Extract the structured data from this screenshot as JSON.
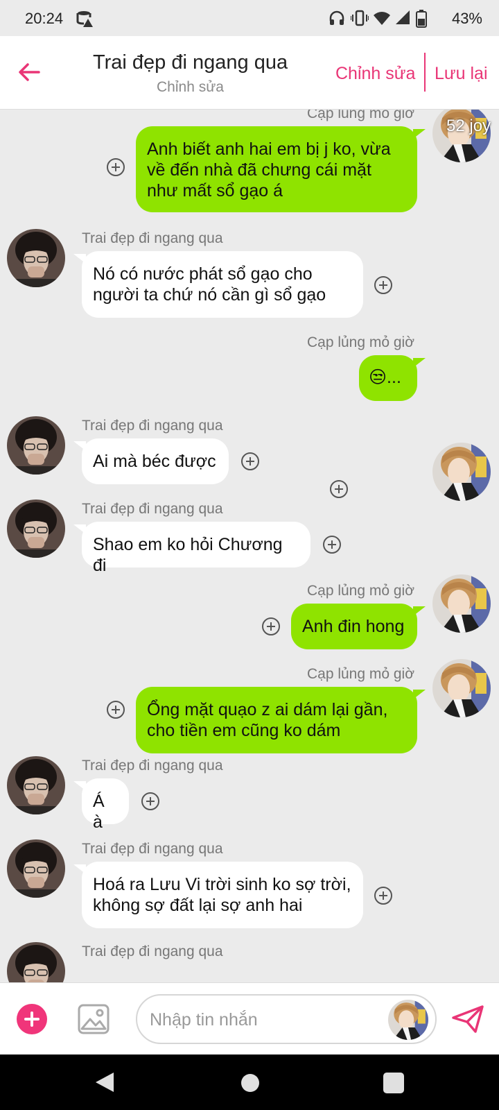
{
  "status_bar": {
    "time": "20:24",
    "battery": "43%",
    "icons": [
      "sim-alert-icon",
      "headphones-icon",
      "vibrate-icon",
      "wifi-icon",
      "signal-icon",
      "battery-icon"
    ]
  },
  "header": {
    "title": "Trai đẹp đi ngang qua",
    "subtitle": "Chỉnh sửa",
    "edit_label": "Chỉnh sửa",
    "save_label": "Lưu lại",
    "accent_color": "#e93576"
  },
  "chat": {
    "overlay_text": "52 joy",
    "messages": [
      {
        "direction": "out",
        "sender": "Cạp lủng mỏ giờ",
        "text": "Anh biết anh hai em bị j ko, vừa\nvề đến nhà đã chưng cái mặt\nnhư mất sổ gạo á"
      },
      {
        "direction": "in",
        "sender": "Trai đẹp đi ngang qua",
        "text": "Nó có nước phát sổ gạo cho\nngười ta chứ nó cần gì sổ gạo"
      },
      {
        "direction": "out",
        "sender": "Cạp lủng mỏ giờ",
        "text": "😒..."
      },
      {
        "direction": "in",
        "sender": "Trai đẹp đi ngang qua",
        "text": "Ai mà béc được"
      },
      {
        "direction": "in",
        "sender": "Trai đẹp đi ngang qua",
        "text": "Shao em ko hỏi Chương đi"
      },
      {
        "direction": "out",
        "sender": "Cạp lủng mỏ giờ",
        "text": "Anh đin hong"
      },
      {
        "direction": "out",
        "sender": "Cạp lủng mỏ giờ",
        "text": "Ổng mặt quạo z ai dám lại gần,\ncho tiền em cũng ko dám"
      },
      {
        "direction": "in",
        "sender": "Trai đẹp đi ngang qua",
        "text": "Á à"
      },
      {
        "direction": "in",
        "sender": "Trai đẹp đi ngang qua",
        "text": "Hoá ra Lưu Vi trời sinh ko sợ trời,\nkhông sợ đất lại sợ anh hai"
      },
      {
        "direction": "in",
        "sender": "Trai đẹp đi ngang qua",
        "text": ""
      }
    ]
  },
  "input": {
    "placeholder": "Nhập tin nhắn",
    "add_color": "#f0357a"
  },
  "colors": {
    "outgoing_bubble": "#8fe300",
    "incoming_bubble": "#ffffff",
    "background": "#ebebeb"
  }
}
